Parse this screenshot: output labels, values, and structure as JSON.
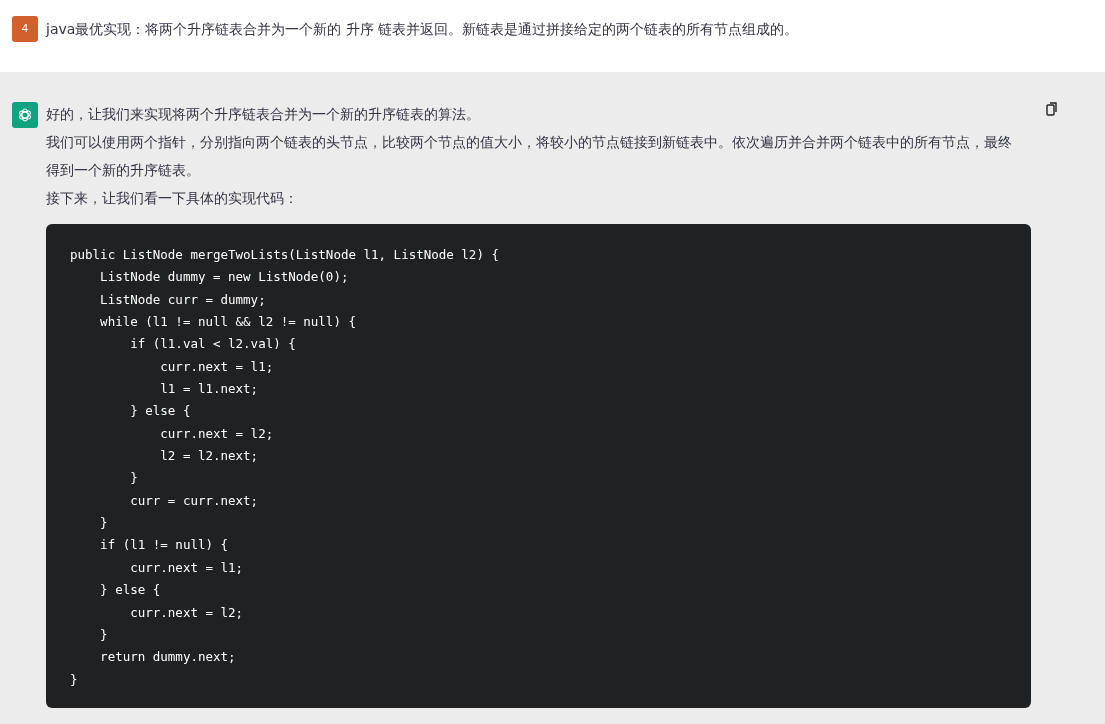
{
  "user_message": {
    "avatar": "4",
    "text": "java最优实现：将两个升序链表合并为一个新的 升序 链表并返回。新链表是通过拼接给定的两个链表的所有节点组成的。"
  },
  "assistant_message": {
    "paragraphs": [
      "好的，让我们来实现将两个升序链表合并为一个新的升序链表的算法。",
      "我们可以使用两个指针，分别指向两个链表的头节点，比较两个节点的值大小，将较小的节点链接到新链表中。依次遍历并合并两个链表中的所有节点，最终得到一个新的升序链表。",
      "接下来，让我们看一下具体的实现代码："
    ],
    "code": [
      "public ListNode mergeTwoLists(ListNode l1, ListNode l2) {",
      "    ListNode dummy = new ListNode(0);",
      "    ListNode curr = dummy;",
      "    while (l1 != null && l2 != null) {",
      "        if (l1.val < l2.val) {",
      "            curr.next = l1;",
      "            l1 = l1.next;",
      "        } else {",
      "            curr.next = l2;",
      "            l2 = l2.next;",
      "        }",
      "        curr = curr.next;",
      "    }",
      "    if (l1 != null) {",
      "        curr.next = l1;",
      "    } else {",
      "        curr.next = l2;",
      "    }",
      "    return dummy.next;",
      "}"
    ]
  }
}
